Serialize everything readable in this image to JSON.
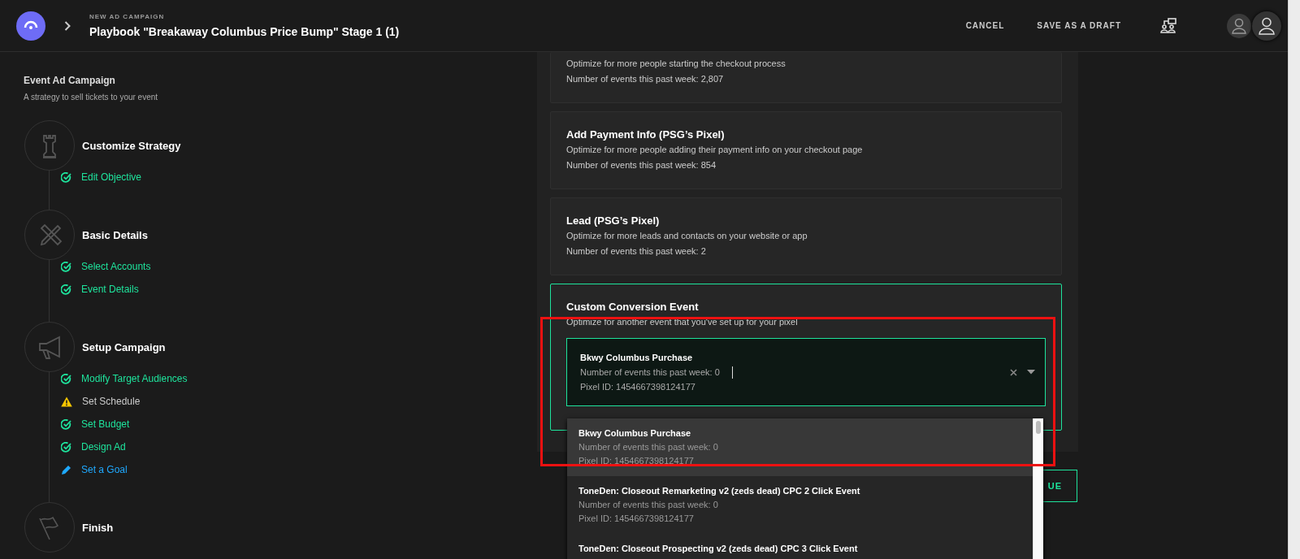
{
  "header": {
    "eyebrow": "NEW AD CAMPAIGN",
    "title": "Playbook \"Breakaway Columbus Price Bump\" Stage 1 (1)",
    "actions": [
      "CANCEL",
      "SAVE AS A DRAFT"
    ]
  },
  "sidebar": {
    "title": "Event Ad Campaign",
    "subtitle": "A strategy to sell tickets to your event",
    "steps": [
      {
        "title": "Customize Strategy",
        "items": [
          {
            "label": "Edit Objective",
            "kind": "done"
          }
        ]
      },
      {
        "title": "Basic Details",
        "items": [
          {
            "label": "Select Accounts",
            "kind": "done"
          },
          {
            "label": "Event Details",
            "kind": "done"
          }
        ]
      },
      {
        "title": "Setup Campaign",
        "items": [
          {
            "label": "Modify Target Audiences",
            "kind": "done"
          },
          {
            "label": "Set Schedule",
            "kind": "warning"
          },
          {
            "label": "Set Budget",
            "kind": "done"
          },
          {
            "label": "Design Ad",
            "kind": "done"
          },
          {
            "label": "Set a Goal",
            "kind": "current"
          }
        ]
      },
      {
        "title": "Finish"
      }
    ]
  },
  "options": [
    {
      "kind": "event",
      "description": "Optimize for more people starting the checkout process",
      "count": "Number of events this past week: 2,807",
      "selected": false
    },
    {
      "kind": "event",
      "title": "Add Payment Info (PSG’s Pixel)",
      "description": "Optimize for more people adding their payment info on your checkout page",
      "count": "Number of events this past week: 854",
      "selected": false
    },
    {
      "kind": "event",
      "title": "Lead (PSG’s Pixel)",
      "description": "Optimize for more leads and contacts on your website or app",
      "count": "Number of events this past week: 2",
      "selected": false
    },
    {
      "kind": "custom",
      "title": "Custom Conversion Event",
      "description": "Optimize for another event that you've set up for your pixel",
      "selected": true,
      "value": {
        "name": "Bkwy Columbus Purchase",
        "count": "Number of events this past week: 0",
        "pixel": "Pixel ID: 1454667398124177"
      }
    }
  ],
  "dropdown": {
    "items": [
      {
        "name": "Bkwy Columbus Purchase",
        "count": "Number of events this past week: 0",
        "pixel": "Pixel ID: 1454667398124177",
        "selected": true
      },
      {
        "name": "ToneDen: Closeout Remarketing v2 (zeds dead) CPC 2 Click Event",
        "count": "Number of events this past week: 0",
        "pixel": "Pixel ID: 1454667398124177",
        "selected": false
      },
      {
        "name": "ToneDen: Closeout Prospecting v2 (zeds dead) CPC 3 Click Event",
        "selected": false
      }
    ]
  },
  "continue_button": {
    "label": "UE"
  }
}
